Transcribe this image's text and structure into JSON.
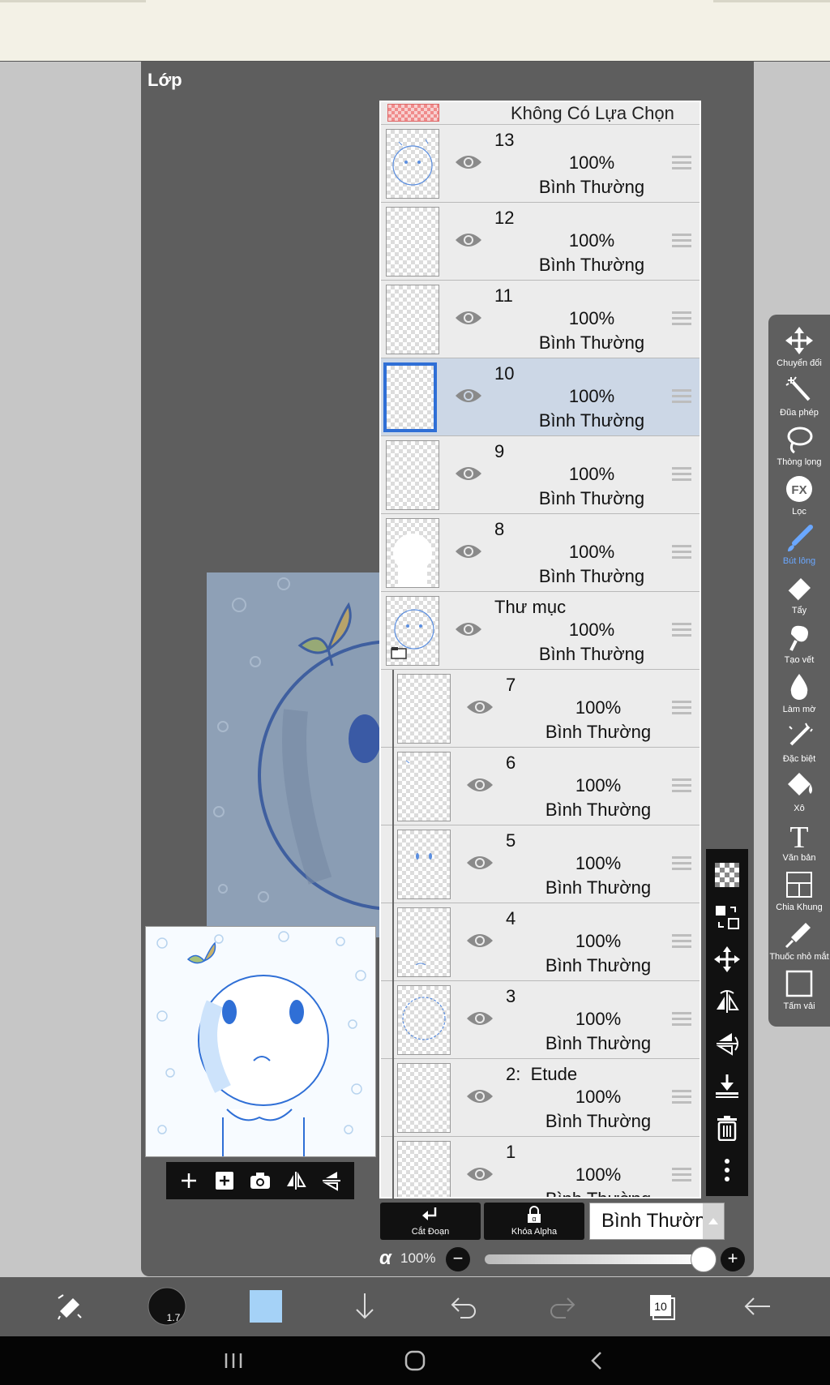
{
  "dialog": {
    "title": "Lớp"
  },
  "selection": {
    "label": "Không Có Lựa Chọn"
  },
  "layers": [
    {
      "name": "13",
      "opacity": "100%",
      "blend": "Bình Thường",
      "selected": false
    },
    {
      "name": "12",
      "opacity": "100%",
      "blend": "Bình Thường",
      "selected": false
    },
    {
      "name": "11",
      "opacity": "100%",
      "blend": "Bình Thường",
      "selected": false
    },
    {
      "name": "10",
      "opacity": "100%",
      "blend": "Bình Thường",
      "selected": true
    },
    {
      "name": "9",
      "opacity": "100%",
      "blend": "Bình Thường",
      "selected": false
    },
    {
      "name": "8",
      "opacity": "100%",
      "blend": "Bình Thường",
      "selected": false
    },
    {
      "name": "Thư mục",
      "opacity": "100%",
      "blend": "Bình Thường",
      "selected": false
    },
    {
      "name": "7",
      "opacity": "100%",
      "blend": "Bình Thường",
      "selected": false
    },
    {
      "name": "6",
      "opacity": "100%",
      "blend": "Bình Thường",
      "selected": false
    },
    {
      "name": "5",
      "opacity": "100%",
      "blend": "Bình Thường",
      "selected": false
    },
    {
      "name": "4",
      "opacity": "100%",
      "blend": "Bình Thường",
      "selected": false
    },
    {
      "name": "3",
      "opacity": "100%",
      "blend": "Bình Thường",
      "selected": false
    },
    {
      "name": "2:  Etude",
      "opacity": "100%",
      "blend": "Bình Thường",
      "selected": false
    },
    {
      "name": "1",
      "opacity": "100%",
      "blend": "Bình Thường",
      "selected": false
    }
  ],
  "controls": {
    "clip_label": "Cắt Đoạn",
    "alpha_lock_label": "Khóa Alpha",
    "blend_mode": "Bình Thường",
    "alpha_symbol": "α",
    "alpha_value": "100%",
    "alpha_fraction": 1.0
  },
  "tools": [
    {
      "label": "Chuyển đổi",
      "icon": "move-arrows-icon"
    },
    {
      "label": "Đũa phép",
      "icon": "magic-wand-icon"
    },
    {
      "label": "Thòng lọng",
      "icon": "lasso-icon"
    },
    {
      "label": "Lọc",
      "icon": "fx-filter-icon"
    },
    {
      "label": "Bút lông",
      "icon": "brush-icon",
      "active": true
    },
    {
      "label": "Tẩy",
      "icon": "eraser-icon"
    },
    {
      "label": "Tạo vết",
      "icon": "smudge-icon"
    },
    {
      "label": "Làm mờ",
      "icon": "blur-drop-icon"
    },
    {
      "label": "Đặc biệt",
      "icon": "special-brush-icon"
    },
    {
      "label": "Xô",
      "icon": "bucket-icon"
    },
    {
      "label": "Văn bản",
      "icon": "text-icon"
    },
    {
      "label": "Chia Khung",
      "icon": "frame-divider-icon"
    },
    {
      "label": "Thuốc nhỏ mắt",
      "icon": "eyedropper-icon"
    },
    {
      "label": "Tấm vải",
      "icon": "canvas-icon"
    }
  ],
  "bottom_bar": {
    "brush_size": "1.7",
    "layer_count": "10",
    "color": "#a5d2f7"
  },
  "colors": {
    "accent": "#2f6fd6",
    "selected_row": "#ccd7e6",
    "active_tool": "#6aa7ff"
  }
}
